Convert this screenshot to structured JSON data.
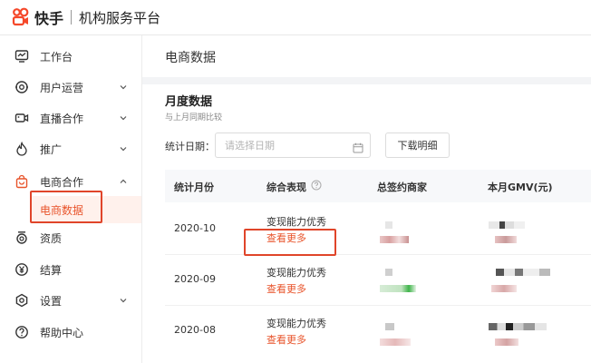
{
  "header": {
    "brand": "快手",
    "platform": "机构服务平台"
  },
  "sidebar": {
    "items": [
      {
        "label": "工作台",
        "icon": "dashboard-icon"
      },
      {
        "label": "用户运营",
        "icon": "user-ops-icon",
        "arrow": "chevron-down-icon"
      },
      {
        "label": "直播合作",
        "icon": "live-camera-icon",
        "arrow": "chevron-down-icon"
      },
      {
        "label": "推广",
        "icon": "flame-icon",
        "arrow": "chevron-down-icon"
      },
      {
        "label": "电商合作",
        "icon": "shopping-bag-icon",
        "arrow": "chevron-up-icon"
      },
      {
        "label": "资质",
        "icon": "badge-icon"
      },
      {
        "label": "结算",
        "icon": "yen-circle-icon"
      },
      {
        "label": "设置",
        "icon": "gear-icon",
        "arrow": "chevron-down-icon"
      },
      {
        "label": "帮助中心",
        "icon": "help-circle-icon"
      }
    ],
    "active_sub": "电商数据"
  },
  "main": {
    "title": "电商数据",
    "section_title": "月度数据",
    "section_subtitle": "与上月同期比较",
    "date_label": "统计日期：",
    "date_placeholder": "请选择日期",
    "download_label": "下载明细",
    "columns": [
      "统计月份",
      "综合表现",
      "总签约商家",
      "本月GMV(元)"
    ],
    "rows": [
      {
        "month": "2020-10",
        "performance": "变现能力优秀",
        "more": "查看更多"
      },
      {
        "month": "2020-09",
        "performance": "变现能力优秀",
        "more": "查看更多"
      },
      {
        "month": "2020-08",
        "performance": "变现能力优秀",
        "more": "查看更多"
      }
    ]
  },
  "colors": {
    "accent": "#e8542b",
    "highlight": "#e0452a",
    "sub_bg": "#fff1ec"
  }
}
